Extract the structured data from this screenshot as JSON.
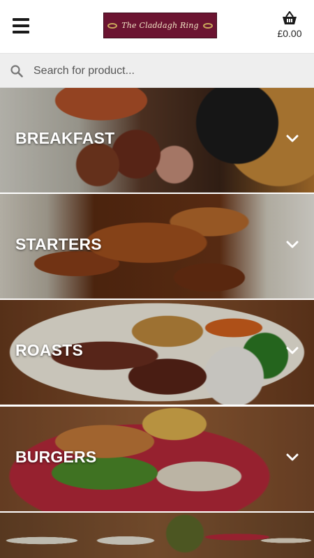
{
  "header": {
    "logo_text": "The Claddagh Ring",
    "cart_total": "£0.00"
  },
  "search": {
    "placeholder": "Search for product..."
  },
  "categories": [
    {
      "label": "BREAKFAST"
    },
    {
      "label": "STARTERS"
    },
    {
      "label": "ROASTS"
    },
    {
      "label": "BURGERS"
    }
  ],
  "icons": {
    "menu": "hamburger-menu-icon",
    "cart": "basket-icon",
    "search": "search-icon",
    "expand": "chevron-down-icon"
  },
  "colors": {
    "logo_background": "#6b1431",
    "logo_text": "#f3e6c6",
    "search_bar": "#eeeeee",
    "category_label": "#ffffff"
  }
}
